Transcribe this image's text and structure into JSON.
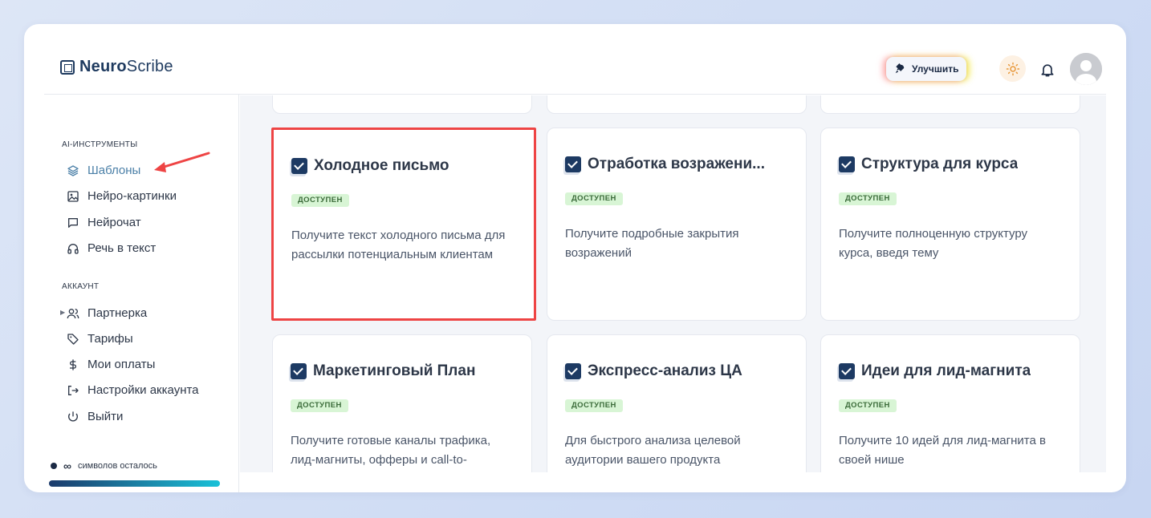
{
  "brand": {
    "bold": "Neuro",
    "regular": "Scribe"
  },
  "header": {
    "upgrade_label": "Улучшить"
  },
  "sidebar": {
    "section_tools": "AI-ИНСТРУМЕНТЫ",
    "tools": [
      {
        "label": "Шаблоны",
        "icon": "layers-icon",
        "active": true
      },
      {
        "label": "Нейро-картинки",
        "icon": "image-icon"
      },
      {
        "label": "Нейрочат",
        "icon": "chat-icon"
      },
      {
        "label": "Речь в текст",
        "icon": "headphones-icon"
      }
    ],
    "section_account": "АККАУНТ",
    "account": [
      {
        "label": "Партнерка",
        "icon": "users-icon"
      },
      {
        "label": "Тарифы",
        "icon": "tag-icon"
      },
      {
        "label": "Мои оплаты",
        "icon": "dollar-icon"
      },
      {
        "label": "Настройки аккаунта",
        "icon": "login-icon"
      },
      {
        "label": "Выйти",
        "icon": "power-icon"
      }
    ],
    "credits_value": "∞",
    "credits_text": "символов осталось"
  },
  "cards": [
    {
      "title": "Холодное письмо",
      "badge": "ДОСТУПЕН",
      "description": "Получите текст холодного письма для рассылки потенциальным клиентам"
    },
    {
      "title": "Отработка возражени...",
      "badge": "ДОСТУПЕН",
      "description": "Получите подробные закрытия возражений"
    },
    {
      "title": "Структура для курса",
      "badge": "ДОСТУПЕН",
      "description": "Получите полноценную структуру курса, введя тему"
    },
    {
      "title": "Маркетинговый План",
      "badge": "ДОСТУПЕН",
      "description": "Получите готовые каналы трафика, лид-магниты, офферы и call-to-"
    },
    {
      "title": "Экспресс-анализ ЦА",
      "badge": "ДОСТУПЕН",
      "description": "Для быстрого анализа целевой аудитории вашего продукта"
    },
    {
      "title": "Идеи для лид-магнита",
      "badge": "ДОСТУПЕН",
      "description": "Получите 10 идей для лид-магнита в своей нише"
    }
  ],
  "colors": {
    "accent": "#4a7fa7",
    "brand_dark": "#1e3a5f",
    "highlight": "#ee4444",
    "badge_bg": "#d8f5d5",
    "annotation_arrow": "#ee4444"
  }
}
